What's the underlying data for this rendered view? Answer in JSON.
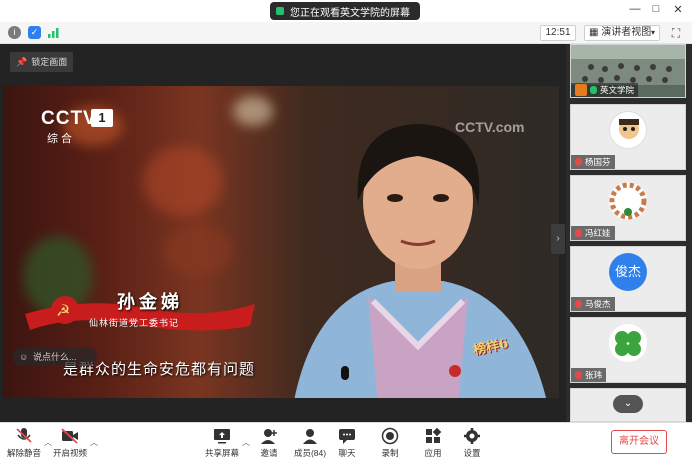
{
  "window": {
    "share_banner": "您正在观看英文学院的屏幕",
    "controls": [
      "—",
      "□",
      "✕"
    ]
  },
  "top_toolbar": {
    "time": "12:51",
    "view_mode": "演讲者视图"
  },
  "main": {
    "lock_label": "锁定画面",
    "video": {
      "channel_logo": "CCTV",
      "channel_number": "1",
      "channel_sub": "综合",
      "watermark": "CCTV.com",
      "person_name": "孙金娣",
      "person_title": "仙林街道党工委书记",
      "subtitle": "是群众的生命安危都有问题",
      "comment_placeholder": "说点什么...",
      "brand_mark": "榜样6"
    }
  },
  "participants": [
    {
      "name": "英文学院",
      "type": "video"
    },
    {
      "name": "杨国芬",
      "type": "avatar"
    },
    {
      "name": "冯红娃",
      "type": "avatar"
    },
    {
      "name": "马俊杰",
      "type": "initial",
      "initial": "俊杰"
    },
    {
      "name": "张玮",
      "type": "avatar"
    }
  ],
  "bottom_bar": {
    "unmute": "解除静音",
    "start_video": "开启视频",
    "share_screen": "共享屏幕",
    "invite": "邀请",
    "members": "成员(84)",
    "chat": "聊天",
    "record": "录制",
    "apps": "应用",
    "settings": "设置",
    "leave": "离开会议"
  },
  "colors": {
    "accent_red": "#e34a4a",
    "accent_green": "#25c06d",
    "accent_blue": "#2f80ed"
  }
}
